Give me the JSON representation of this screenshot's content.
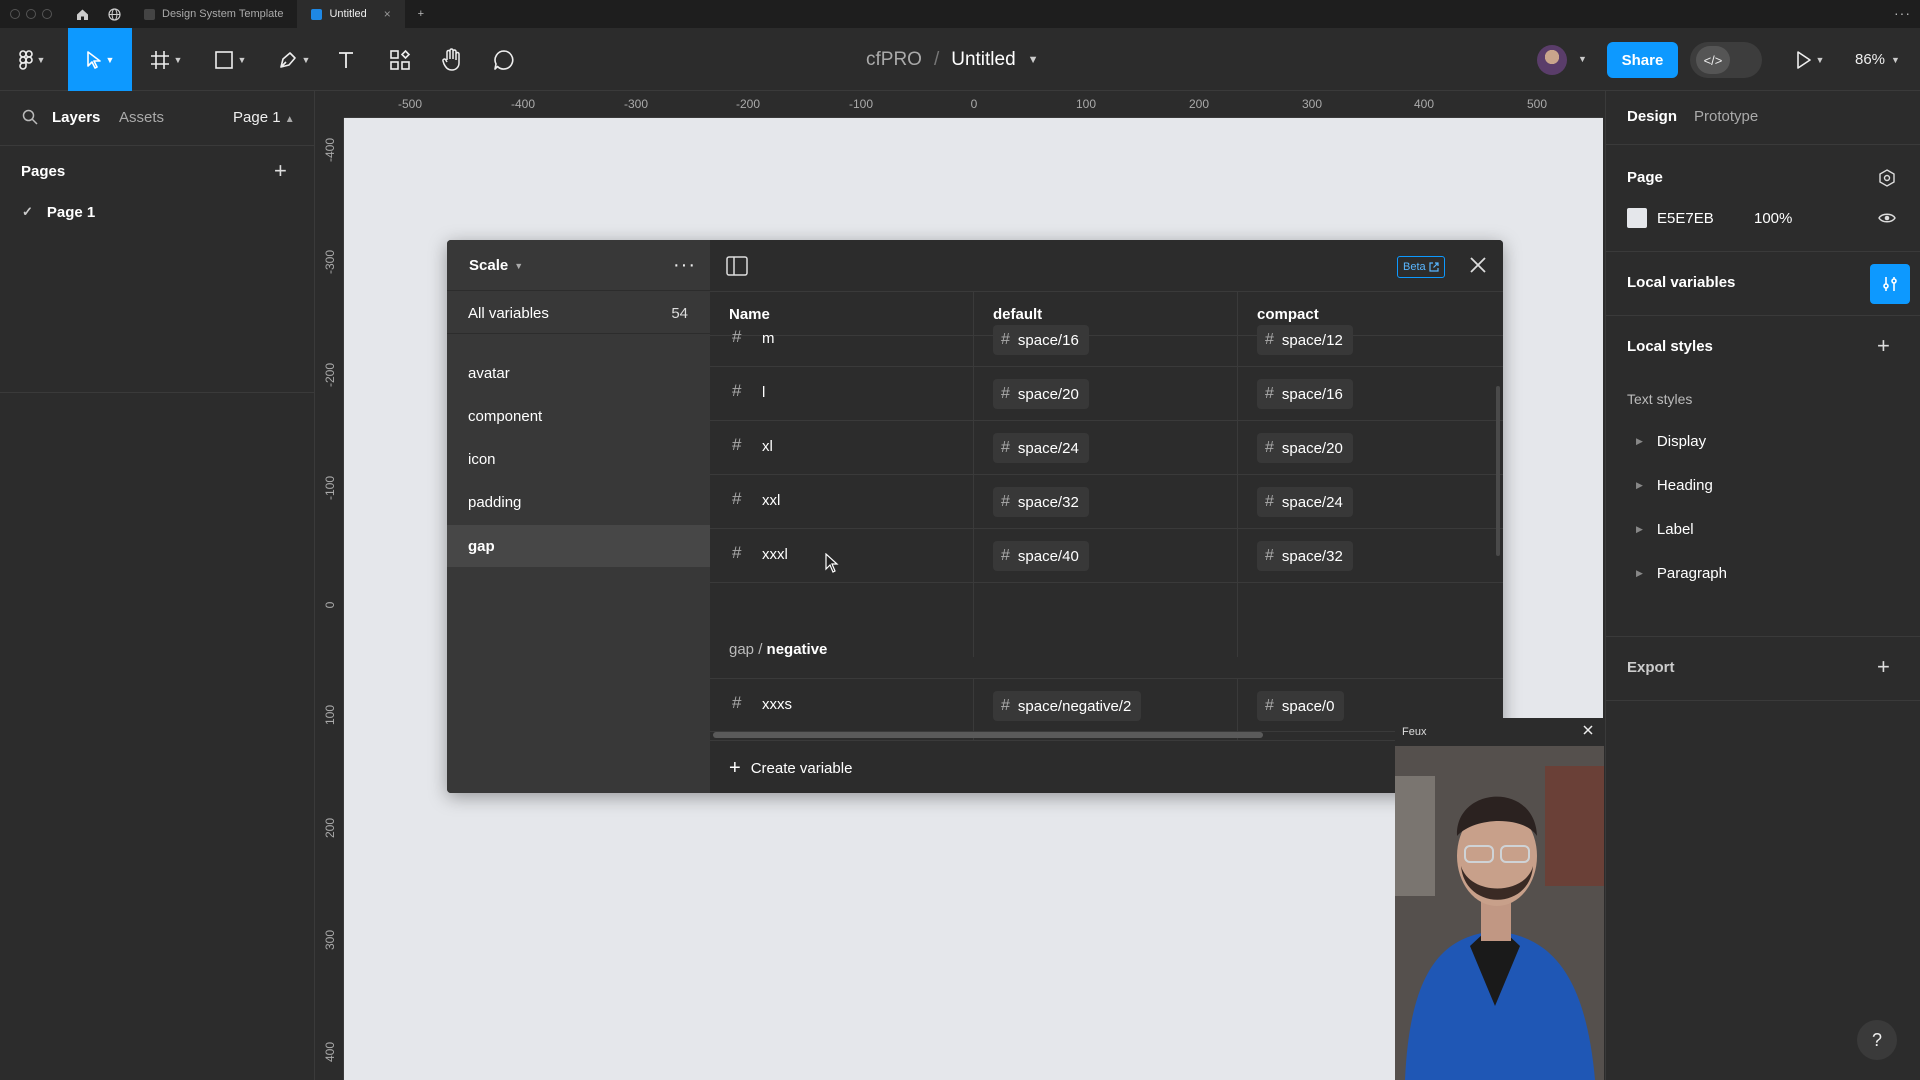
{
  "browser": {
    "tabs": [
      {
        "label": "Design System Template"
      },
      {
        "label": "Untitled",
        "close": "×"
      }
    ],
    "new_tab": "+"
  },
  "toolbar": {
    "team": "cfPRO",
    "separator": "/",
    "file_name": "Untitled",
    "share_label": "Share",
    "zoom": "86%"
  },
  "left_panel": {
    "tabs": {
      "layers": "Layers",
      "assets": "Assets",
      "page_selector": "Page 1"
    },
    "pages_title": "Pages",
    "pages": [
      {
        "name": "Page 1",
        "current": true
      }
    ]
  },
  "rulers": {
    "top": [
      "-500",
      "-400",
      "-300",
      "-200",
      "-100",
      "0",
      "100",
      "200",
      "300",
      "400",
      "500"
    ],
    "left": [
      "-400",
      "-300",
      "-200",
      "-100",
      "0",
      "100",
      "200",
      "300",
      "400"
    ]
  },
  "variables": {
    "collection": "Scale",
    "all_label": "All variables",
    "all_count": "54",
    "groups": [
      "avatar",
      "component",
      "icon",
      "padding",
      "gap"
    ],
    "selected_group": "gap",
    "beta": "Beta",
    "columns": {
      "name": "Name",
      "mode1": "default",
      "mode2": "compact"
    },
    "rows": [
      {
        "name": "m",
        "default": "space/16",
        "compact": "space/12"
      },
      {
        "name": "l",
        "default": "space/20",
        "compact": "space/16"
      },
      {
        "name": "xl",
        "default": "space/24",
        "compact": "space/20"
      },
      {
        "name": "xxl",
        "default": "space/32",
        "compact": "space/24"
      },
      {
        "name": "xxxl",
        "default": "space/40",
        "compact": "space/32"
      }
    ],
    "subgroup": {
      "parent": "gap",
      "separator": "/",
      "child": "negative"
    },
    "sub_rows": [
      {
        "name": "xxxs",
        "default": "space/negative/2",
        "compact": "space/0"
      }
    ],
    "create_label": "Create variable"
  },
  "right_panel": {
    "tabs": {
      "design": "Design",
      "prototype": "Prototype"
    },
    "page": {
      "title": "Page",
      "color": "E5E7EB",
      "opacity": "100%",
      "swatch": "#E5E7EB"
    },
    "local_variables": "Local variables",
    "local_styles": "Local styles",
    "text_styles_title": "Text styles",
    "text_styles": [
      "Display",
      "Heading",
      "Label",
      "Paragraph"
    ],
    "export": "Export"
  },
  "webcam": {
    "name": "Feux"
  },
  "help": "?",
  "colors": {
    "accent": "#0d99ff",
    "canvas": "#E5E7EB",
    "panel": "#2c2c2c"
  }
}
